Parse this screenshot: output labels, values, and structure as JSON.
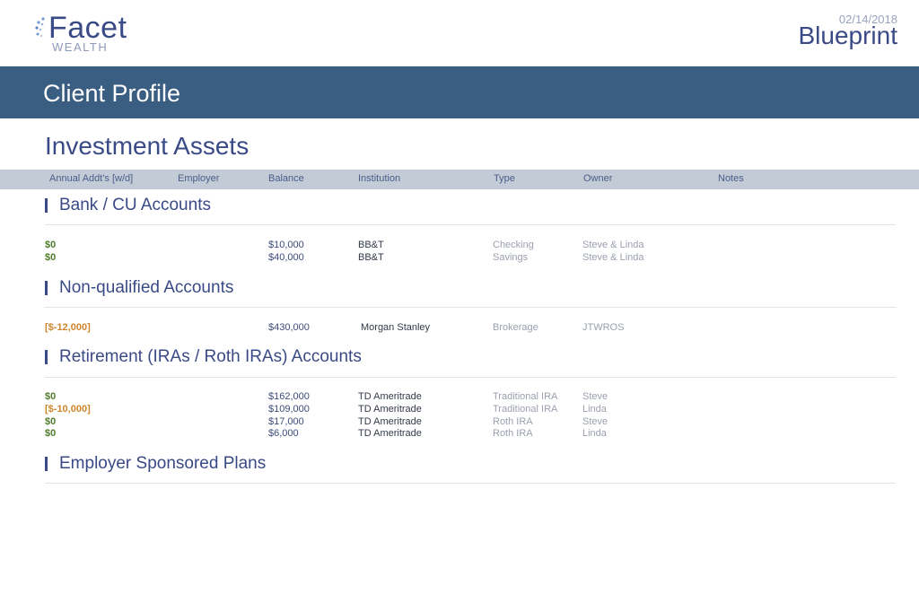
{
  "header": {
    "logo_name": "Facet",
    "logo_sub": "WEALTH",
    "date": "02/14/2018",
    "doc_title": "Blueprint"
  },
  "banner": {
    "title": "Client Profile"
  },
  "section": {
    "title": "Investment Assets"
  },
  "columns": [
    "Annual Addt's [w/d]",
    "Employer",
    "Balance",
    "Institution",
    "Type",
    "Owner",
    "Notes"
  ],
  "groups": [
    {
      "title": "Bank / CU Accounts",
      "rows": [
        {
          "addt": "$0",
          "addt_color": "#4f7a2a",
          "balance": "$10,000",
          "institution": "BB&T",
          "type": "Checking",
          "owner": "Steve & Linda"
        },
        {
          "addt": "$0",
          "addt_color": "#4f7a2a",
          "balance": "$40,000",
          "institution": "BB&T",
          "type": "Savings",
          "owner": "Steve & Linda"
        }
      ]
    },
    {
      "title": "Non-qualified Accounts",
      "rows": [
        {
          "addt": "[$-12,000]",
          "addt_color": "#d0862c",
          "balance": "$430,000",
          "institution": "Morgan Stanley",
          "type": "Brokerage",
          "owner": "JTWROS"
        }
      ]
    },
    {
      "title": "Retirement (IRAs / Roth IRAs) Accounts",
      "rows": [
        {
          "addt": "$0",
          "addt_color": "#4f7a2a",
          "balance": "$162,000",
          "institution": "TD Ameritrade",
          "type": "Traditional IRA",
          "owner": "Steve"
        },
        {
          "addt": "[$-10,000]",
          "addt_color": "#d0862c",
          "balance": "$109,000",
          "institution": "TD Ameritrade",
          "type": "Traditional IRA",
          "owner": "Linda"
        },
        {
          "addt": "$0",
          "addt_color": "#4f7a2a",
          "balance": "$17,000",
          "institution": "TD Ameritrade",
          "type": "Roth IRA",
          "owner": "Steve"
        },
        {
          "addt": "$0",
          "addt_color": "#4f7a2a",
          "balance": "$6,000",
          "institution": "TD Ameritrade",
          "type": "Roth IRA",
          "owner": "Linda"
        }
      ]
    },
    {
      "title": "Employer Sponsored Plans",
      "rows": []
    }
  ]
}
